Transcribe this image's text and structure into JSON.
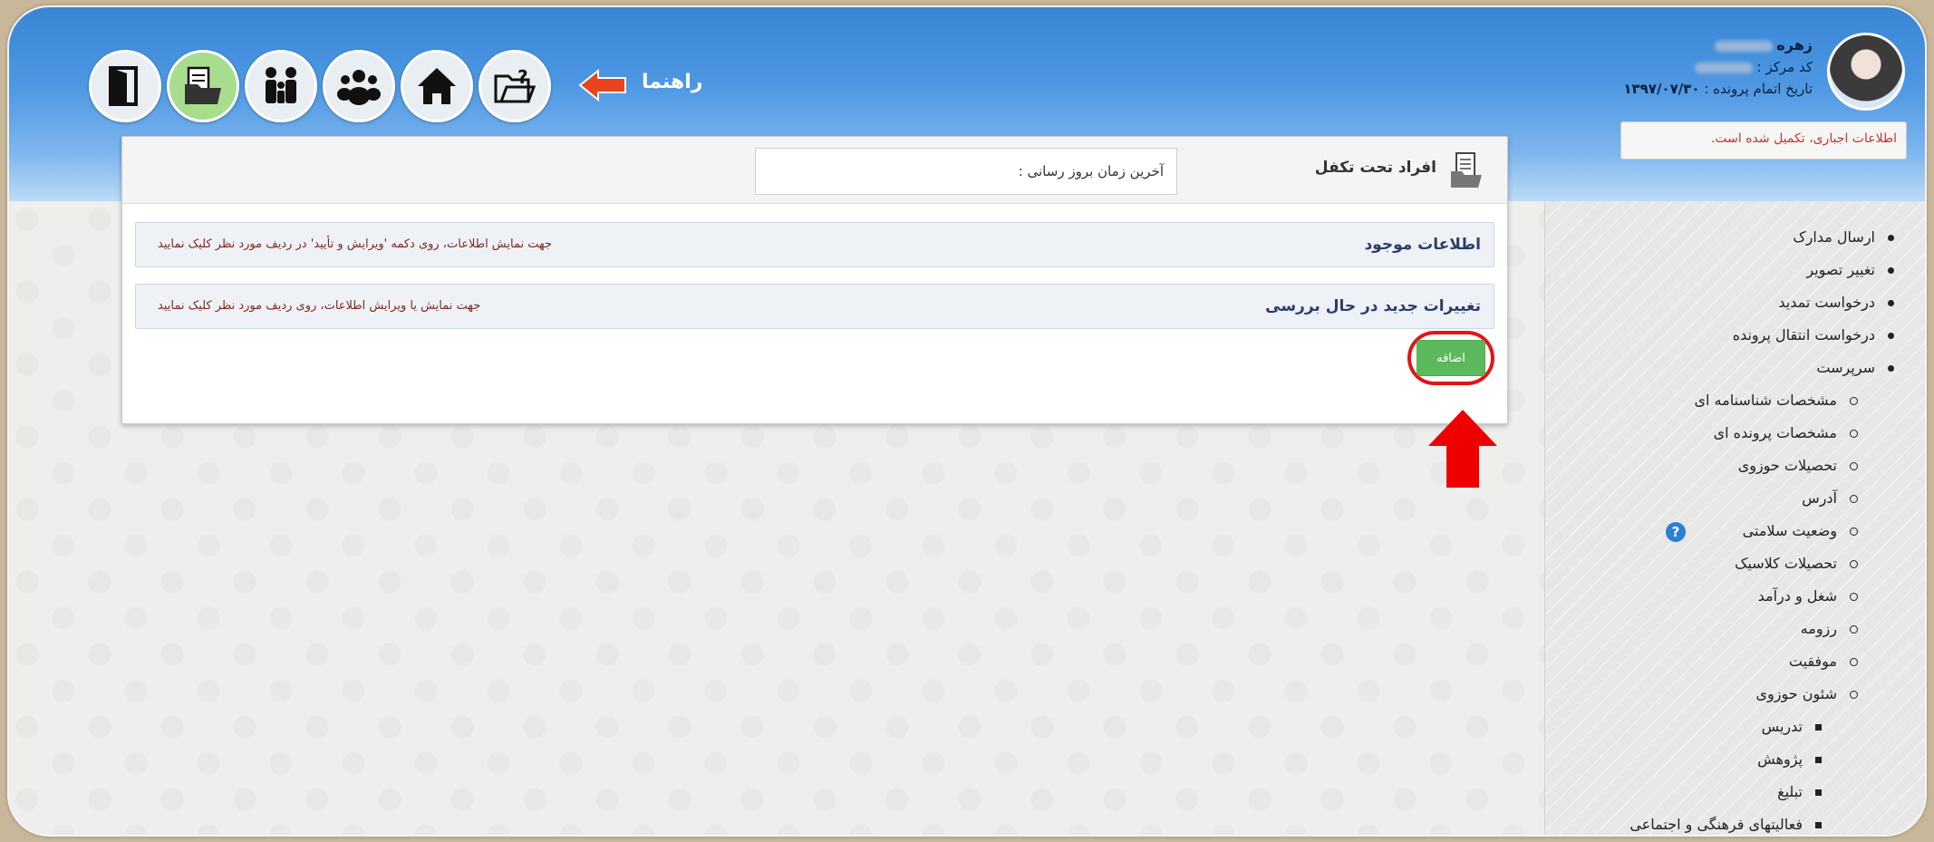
{
  "header": {
    "help_label": "راهنما",
    "toolbar_icons": [
      "exit-icon",
      "files-icon",
      "family-icon",
      "group-icon",
      "home-icon",
      "help-folder-icon"
    ]
  },
  "user": {
    "name": "زهره",
    "center_code_label": "کد مرکز :",
    "file_completion_label": "تاریخ اتمام پرونده :",
    "file_completion_date": "۱۳۹۷/۰۷/۳۰",
    "notice": "اطلاعات اجباری، تکمیل شده است."
  },
  "panel": {
    "title": "افراد تحت تکفل",
    "last_update_label": "آخرین زمان بروز رسانی :",
    "sections": [
      {
        "title": "اطلاعات موجود",
        "hint": "جهت نمایش اطلاعات، روی دکمه 'ویرایش و تأیید' در ردیف مورد نظر کلیک نمایید"
      },
      {
        "title": "تغییرات جدید در حال بررسی",
        "hint": "جهت نمایش یا ویرایش اطلاعات، روی ردیف مورد نظر کلیک نمایید"
      }
    ],
    "add_button": "اضافه"
  },
  "sidebar": {
    "items": [
      {
        "label": "ارسال مدارک",
        "level": 1
      },
      {
        "label": "تغییر تصویر",
        "level": 1
      },
      {
        "label": "درخواست تمدید",
        "level": 1
      },
      {
        "label": "درخواست انتقال پرونده",
        "level": 1
      },
      {
        "label": "سرپرست",
        "level": 1
      },
      {
        "label": "مشخصات شناسنامه ای",
        "level": 2
      },
      {
        "label": "مشخصات پرونده ای",
        "level": 2
      },
      {
        "label": "تحصیلات حوزوی",
        "level": 2
      },
      {
        "label": "آدرس",
        "level": 2
      },
      {
        "label": "وضعیت سلامتی",
        "level": 2
      },
      {
        "label": "تحصیلات کلاسیک",
        "level": 2
      },
      {
        "label": "شغل و درآمد",
        "level": 2
      },
      {
        "label": "رزومه",
        "level": 2
      },
      {
        "label": "موفقیت",
        "level": 2
      },
      {
        "label": "شئون حوزوی",
        "level": 2
      },
      {
        "label": "تدریس",
        "level": 3
      },
      {
        "label": "پژوهش",
        "level": 3
      },
      {
        "label": "تبلیغ",
        "level": 3
      },
      {
        "label": "فعالیتهای فرهنگی و اجتماعی",
        "level": 3
      }
    ],
    "help_badge": "?"
  },
  "colors": {
    "header_blue": "#3a86d6",
    "add_green": "#5cb85c",
    "highlight_red": "#e01515",
    "notice_red": "#c0392b"
  }
}
